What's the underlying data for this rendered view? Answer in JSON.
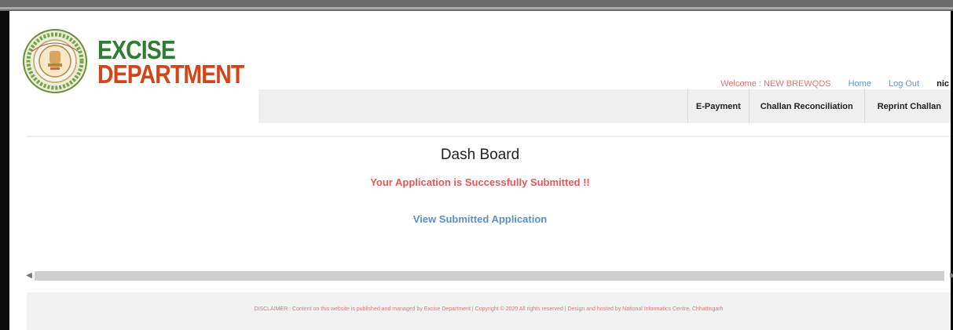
{
  "brand": {
    "line1": "EXCISE",
    "line2": "DEPARTMENT",
    "logo_icon": "state-emblem-seal-icon"
  },
  "userbar": {
    "welcome": "Welcome : NEW BREWQDS",
    "home": "Home",
    "logout": "Log Out",
    "user": "nic"
  },
  "menu": {
    "items": [
      "E-Payment",
      "Challan Reconciliation",
      "Reprint Challan"
    ]
  },
  "main": {
    "title": "Dash Board",
    "success_message": "Your Application is Successfully Submitted !!",
    "view_link": "View Submitted Application"
  },
  "footer": {
    "disclaimer": "DISCLAIMER : Content on this website is published and managed by Excise Department | Copyright © 2020 All rights reserved | Design and hosted by National Informatics Centre, Chhattisgarh"
  },
  "colors": {
    "brand_green": "#2e7d32",
    "brand_orange": "#d84315",
    "alert_red": "#e05a5a",
    "link_blue": "#5b8fc9"
  }
}
